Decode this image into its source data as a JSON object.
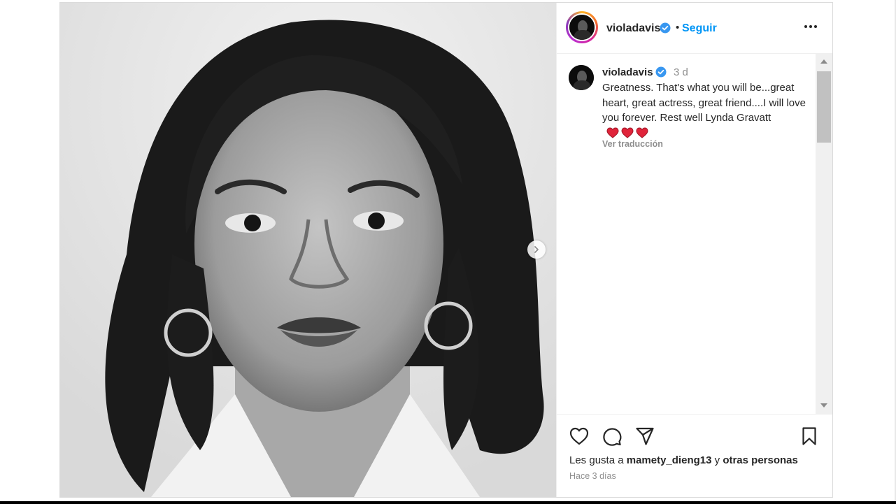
{
  "post": {
    "username": "violadavis",
    "follow_label": "Seguir",
    "dot": "•",
    "caption": {
      "username": "violadavis",
      "time": "3 d",
      "text": "Greatness. That's what you will be...great heart, great actress, great friend....I will love you forever. Rest well Lynda Gravatt",
      "translate": "Ver traducción"
    },
    "likes": {
      "prefix": "Les gusta a",
      "user": "mamety_dieng13",
      "middle": "y",
      "suffix": "otras personas"
    },
    "posted": "Hace 3 días"
  },
  "colors": {
    "accent": "#0095f6",
    "verified": "#3897f0",
    "heart": "#e0243a",
    "muted": "#8e8e8e"
  },
  "icons": {
    "verified": "verified-badge-icon",
    "more": "more-options-icon",
    "next": "chevron-right-icon",
    "like": "heart-outline-icon",
    "comment": "comment-icon",
    "share": "paper-plane-icon",
    "save": "bookmark-icon"
  }
}
